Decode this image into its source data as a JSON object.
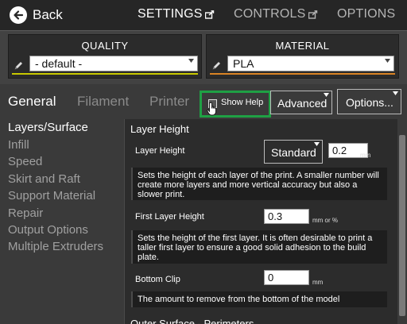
{
  "topnav": {
    "back_label": "Back",
    "tabs": [
      {
        "label": "SETTINGS",
        "icon": "popout-icon"
      },
      {
        "label": "CONTROLS",
        "icon": "popout-icon"
      },
      {
        "label": "OPTIONS"
      }
    ]
  },
  "quality": {
    "title": "QUALITY",
    "value": "- default -",
    "accent_color": "#c8c800"
  },
  "material": {
    "title": "MATERIAL",
    "value": "PLA",
    "accent_color": "#d98324"
  },
  "tabs": {
    "items": [
      "General",
      "Filament",
      "Printer"
    ],
    "show_help_label": "Show Help",
    "advanced_label": "Advanced",
    "options_label": "Options...",
    "highlight_color": "#1fa044"
  },
  "categories": [
    "Layers/Surface",
    "Infill",
    "Speed",
    "Skirt and Raft",
    "Support Material",
    "Repair",
    "Output Options",
    "Multiple Extruders"
  ],
  "panel": {
    "section_title": "Layer Height",
    "layer_height": {
      "label": "Layer Height",
      "preset": "Standard",
      "value": "0.2",
      "unit": "mm",
      "help": "Sets the height of each layer of the print. A smaller number will create more layers and more vertical accuracy but also a slower print."
    },
    "first_layer": {
      "label": "First Layer Height",
      "value": "0.3",
      "unit": "mm or %",
      "help": "Sets the height of the first layer. It is often desirable to print a taller first layer to ensure a good solid adhesion to the build plate."
    },
    "bottom_clip": {
      "label": "Bottom Clip",
      "value": "0",
      "unit": "mm",
      "help": "The amount to remove from the bottom of the model"
    },
    "next_section": "Outer Surface - Perimeters"
  }
}
